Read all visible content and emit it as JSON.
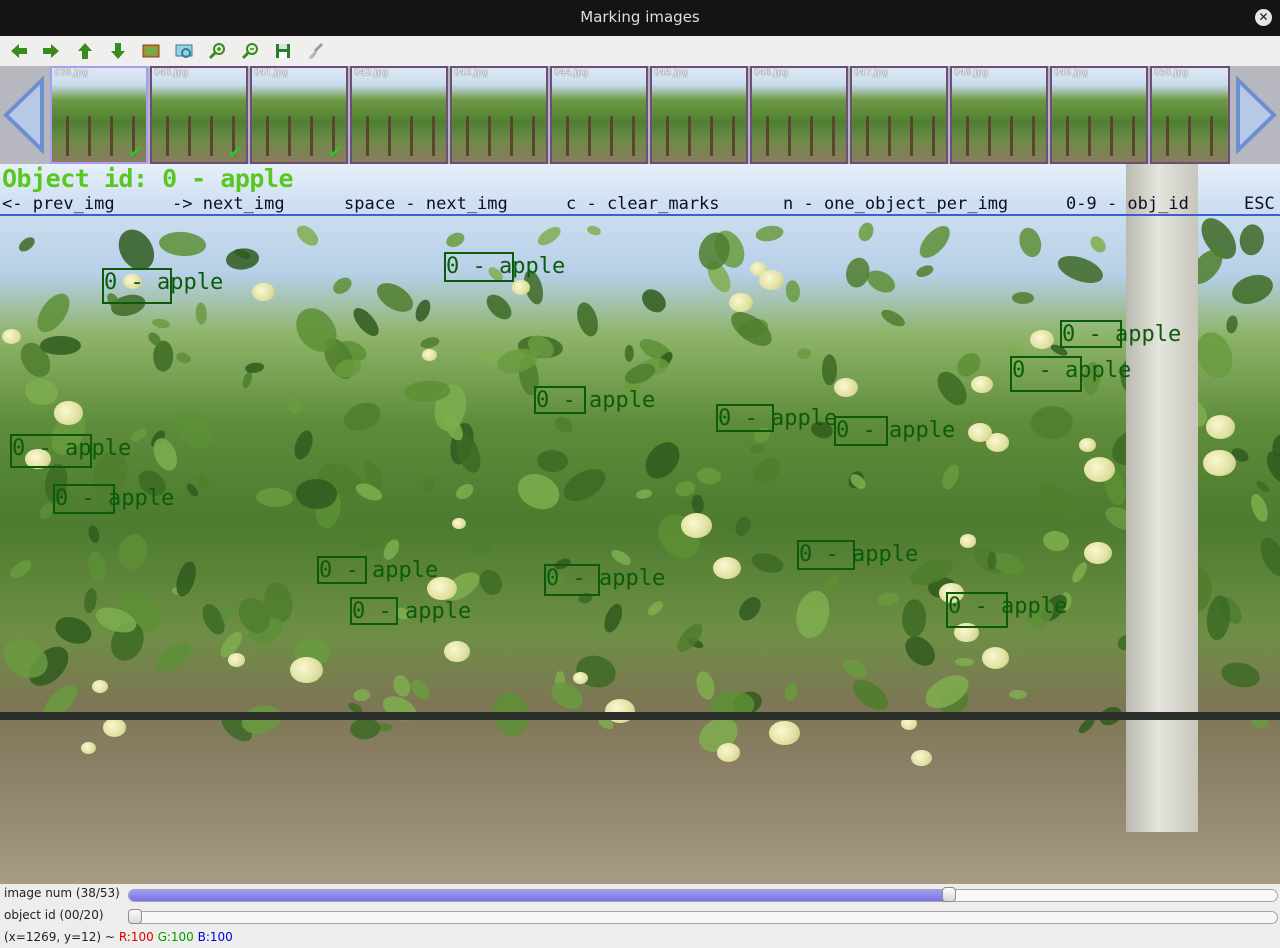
{
  "window": {
    "title": "Marking images",
    "close_icon": "close-icon"
  },
  "toolbar": {
    "buttons": [
      {
        "name": "back-arrow-icon",
        "color": "#3a8a1e"
      },
      {
        "name": "forward-arrow-icon",
        "color": "#3a8a1e"
      },
      {
        "name": "up-arrow-icon",
        "color": "#3a8a1e"
      },
      {
        "name": "down-arrow-icon",
        "color": "#3a8a1e"
      },
      {
        "name": "image-icon",
        "color": "#c77a2e"
      },
      {
        "name": "fit-window-icon",
        "color": "#2f7d9c"
      },
      {
        "name": "zoom-in-icon",
        "color": "#3a8a1e"
      },
      {
        "name": "zoom-out-icon",
        "color": "#3a8a1e"
      },
      {
        "name": "save-icon",
        "color": "#2d7a2d"
      },
      {
        "name": "brush-icon",
        "color": "#9a9a9a"
      }
    ]
  },
  "thumbnails": [
    {
      "file": "038.jpg",
      "checked": true,
      "selected": true
    },
    {
      "file": "040.jpg",
      "checked": true,
      "selected": false
    },
    {
      "file": "041.jpg",
      "checked": true,
      "selected": false
    },
    {
      "file": "042.jpg",
      "checked": false,
      "selected": false
    },
    {
      "file": "043.jpg",
      "checked": false,
      "selected": false
    },
    {
      "file": "044.jpg",
      "checked": false,
      "selected": false
    },
    {
      "file": "045.jpg",
      "checked": false,
      "selected": false
    },
    {
      "file": "046.jpg",
      "checked": false,
      "selected": false
    },
    {
      "file": "047.jpg",
      "checked": false,
      "selected": false
    },
    {
      "file": "048.jpg",
      "checked": false,
      "selected": false
    },
    {
      "file": "049.jpg",
      "checked": false,
      "selected": false
    },
    {
      "file": "050.jpg",
      "checked": false,
      "selected": false
    }
  ],
  "overlay": {
    "object_line": "Object id: 0    - apple",
    "hints": [
      "<- prev_img",
      "-> next_img",
      "space - next_img",
      "c - clear_marks",
      "n - one_object_per_img",
      "0-9 - obj_id",
      "ESC"
    ]
  },
  "annotations": {
    "label": "0 - apple",
    "count": 16
  },
  "controls": {
    "image_num_label": "image num  (38/53)",
    "image_num_value": 38,
    "image_num_max": 53,
    "object_id_label": "object id  (00/20)",
    "object_id_value": 0,
    "object_id_max": 20
  },
  "status": {
    "coords": "(x=1269, y=12) ~",
    "r": "R:100",
    "g": "G:100",
    "b": "B:100",
    "r_color": "#e00000",
    "g_color": "#00a000",
    "b_color": "#0000e0"
  }
}
